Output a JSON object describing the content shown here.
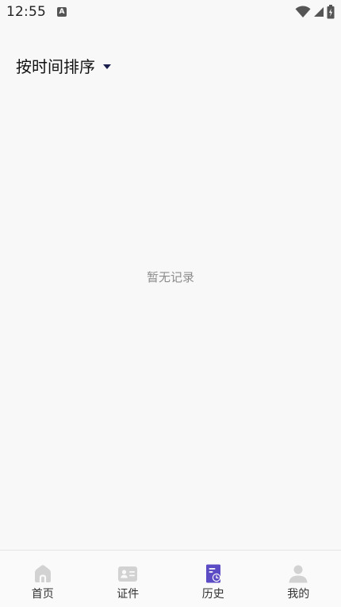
{
  "status_bar": {
    "time": "12:55",
    "notification_icon": "a-icon",
    "icons": [
      "wifi-icon",
      "signal-icon",
      "battery-icon"
    ]
  },
  "sort": {
    "label": "按时间排序",
    "icon": "caret-down-icon"
  },
  "empty_state": {
    "message": "暂无记录"
  },
  "tab_bar": {
    "active_color": "#5b4bc4",
    "inactive_color": "#d2d2d2",
    "tabs": [
      {
        "label": "首页",
        "icon": "home-icon",
        "active": false
      },
      {
        "label": "证件",
        "icon": "id-card-icon",
        "active": false
      },
      {
        "label": "历史",
        "icon": "history-icon",
        "active": true
      },
      {
        "label": "我的",
        "icon": "user-icon",
        "active": false
      }
    ]
  }
}
